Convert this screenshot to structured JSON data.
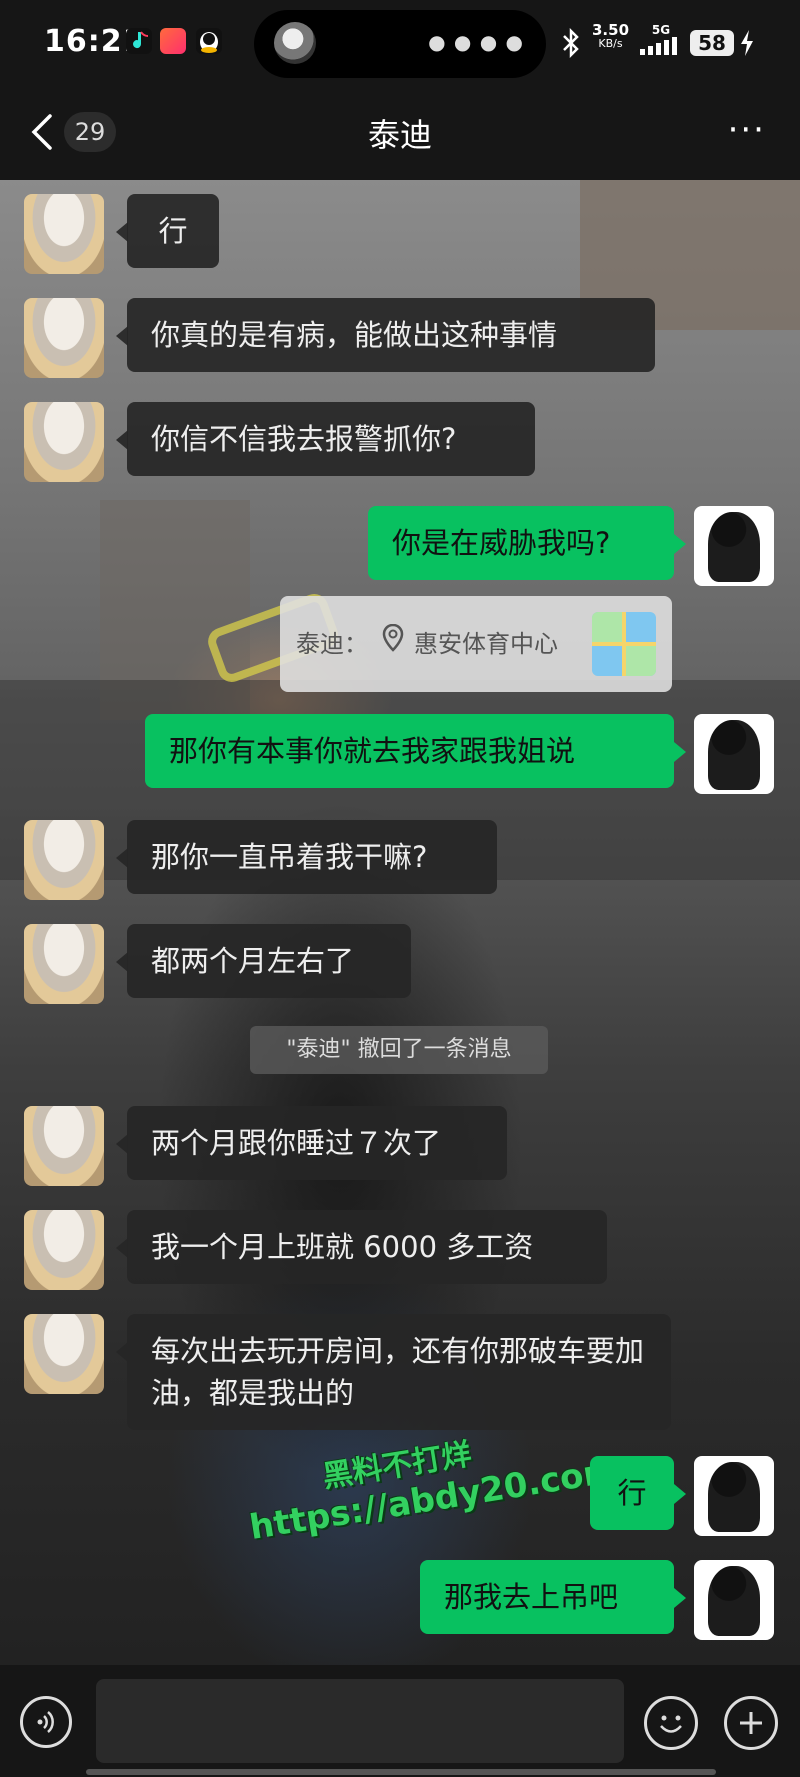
{
  "status_bar": {
    "time": "16:21",
    "net_speed": "3.50",
    "net_unit": "KB/s",
    "network": "5G",
    "battery": "58",
    "icons": [
      "music-app-icon",
      "game-app-icon",
      "penguin-app-icon",
      "island-avatar-icon",
      "bluetooth-icon",
      "signal-icon",
      "charging-icon"
    ]
  },
  "header": {
    "unread_count": "29",
    "title": "泰迪",
    "more": "···"
  },
  "messages": [
    {
      "side": "left",
      "text": "行"
    },
    {
      "side": "left",
      "text": "你真的是有病，能做出这种事情"
    },
    {
      "side": "left",
      "text": "你信不信我去报警抓你?"
    },
    {
      "side": "right",
      "text": "你是在威胁我吗?"
    },
    {
      "side": "right",
      "text": "那你有本事你就去我家跟我姐说"
    },
    {
      "side": "left",
      "text": "那你一直吊着我干嘛?"
    },
    {
      "side": "left",
      "text": "都两个月左右了"
    },
    {
      "side": "left",
      "text": "两个月跟你睡过７次了"
    },
    {
      "side": "left",
      "text": "我一个月上班就 6000 多工资"
    },
    {
      "side": "left",
      "text": "每次出去玩开房间，还有你那破车要加油，都是我出的"
    },
    {
      "side": "right",
      "text": "行"
    },
    {
      "side": "right",
      "text": "那我去上吊吧"
    }
  ],
  "location_share": {
    "sender": "泰迪：",
    "place": "惠安体育中心"
  },
  "system_message": "\"泰迪\" 撤回了一条消息",
  "watermark": {
    "line1": "黑料不打烊",
    "line2": "https://abdy20.com"
  },
  "colors": {
    "accent_green": "#08c160",
    "watermark_green": "#33d060"
  }
}
